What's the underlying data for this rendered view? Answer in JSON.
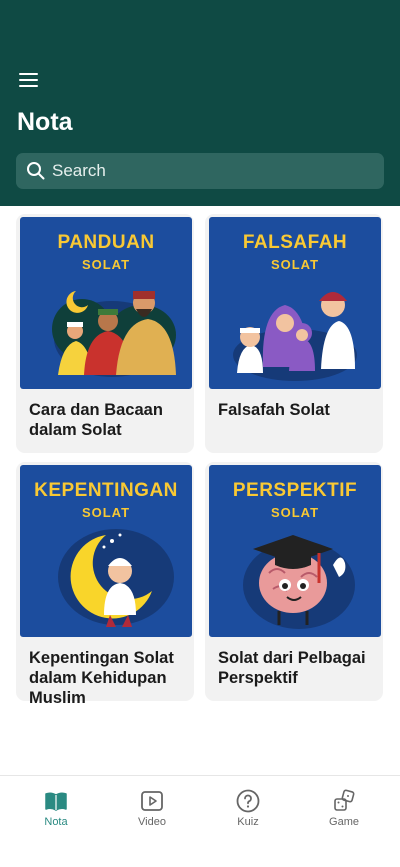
{
  "header": {
    "title": "Nota",
    "menu_icon": "hamburger-menu-icon",
    "background": "#0f4a44"
  },
  "search": {
    "placeholder": "Search",
    "value": "",
    "icon": "search-icon"
  },
  "cards": [
    {
      "image_title": "PANDUAN",
      "image_subtitle": "SOLAT",
      "label": "Cara dan Bacaan dalam Solat"
    },
    {
      "image_title": "FALSAFAH",
      "image_subtitle": "SOLAT",
      "label": "Falsafah Solat"
    },
    {
      "image_title": "KEPENTINGAN",
      "image_subtitle": "SOLAT",
      "label": "Kepentingan Solat dalam Kehidupan Muslim"
    },
    {
      "image_title": "PERSPEKTIF",
      "image_subtitle": "SOLAT",
      "label": "Solat dari Pelbagai Perspektif"
    }
  ],
  "bottom_nav": {
    "items": [
      {
        "label": "Nota",
        "icon": "book-icon",
        "active": true
      },
      {
        "label": "Video",
        "icon": "play-icon",
        "active": false
      },
      {
        "label": "Kuiz",
        "icon": "question-icon",
        "active": false
      },
      {
        "label": "Game",
        "icon": "dice-icon",
        "active": false
      }
    ],
    "active_color": "#2a8a82"
  },
  "colors": {
    "card_image_bg": "#1c4d9e",
    "card_image_text": "#f9c934"
  }
}
